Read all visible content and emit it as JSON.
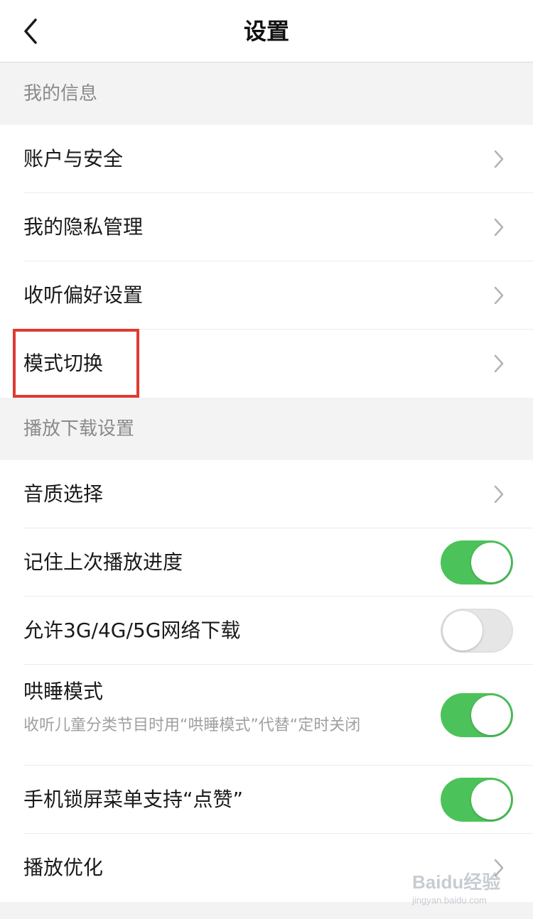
{
  "nav": {
    "title": "设置",
    "back_icon": "chevron-left-icon"
  },
  "sections": {
    "my_info": {
      "header": "我的信息",
      "items": [
        {
          "label": "账户与安全"
        },
        {
          "label": "我的隐私管理"
        },
        {
          "label": "收听偏好设置"
        },
        {
          "label": "模式切换"
        }
      ]
    },
    "playback": {
      "header": "播放下载设置",
      "items": [
        {
          "label": "音质选择"
        },
        {
          "label": "记住上次播放进度",
          "toggle": "on"
        },
        {
          "label": "允许3G/4G/5G网络下载",
          "toggle": "off"
        },
        {
          "label": "哄睡模式",
          "sub": "收听儿童分类节目时用“哄睡模式”代替“定时关闭",
          "toggle": "on"
        },
        {
          "label": "手机锁屏菜单支持“点赞”",
          "toggle": "on"
        },
        {
          "label": "播放优化"
        }
      ]
    }
  },
  "colors": {
    "toggle_on": "#4cc35a",
    "toggle_off": "#e6e6e6",
    "highlight": "#e03a32",
    "background": "#f3f3f3"
  },
  "watermark": {
    "brand": "Baidu经验",
    "url": "jingyan.baidu.com"
  }
}
